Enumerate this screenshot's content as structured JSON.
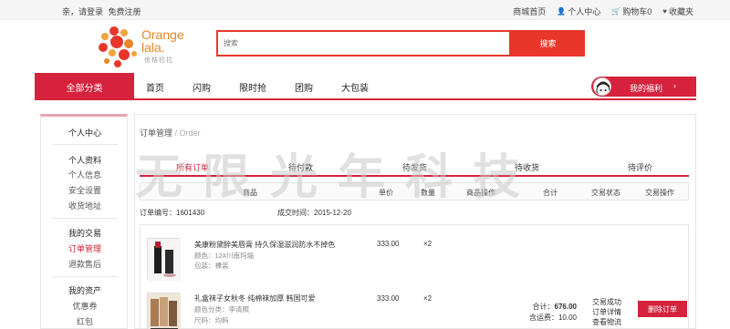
{
  "topbar": {
    "greeting": "亲，请登录",
    "register": "免费注册",
    "mall_home": "商城首页",
    "personal_center": "个人中心",
    "cart": "购物车0",
    "favorites": "收藏夹"
  },
  "header": {
    "logo_line1": "Orange",
    "logo_line2": "lala.",
    "logo_sub": "优桔拉拉",
    "search_placeholder": "搜索",
    "search_button": "搜索"
  },
  "nav": {
    "all_categories": "全部分类",
    "items": [
      "首页",
      "闪购",
      "限时抢",
      "团购",
      "大包装"
    ],
    "benefit": "我的福利",
    "benefit_arrow": "›"
  },
  "sidebar": {
    "title": "个人中心",
    "sections": [
      {
        "head": "个人资料",
        "items": [
          "个人信息",
          "安全设置",
          "收货地址"
        ]
      },
      {
        "head": "我的交易",
        "items": [
          "订单管理",
          "退款售后"
        ]
      },
      {
        "head": "我的资产",
        "items": [
          "优惠券",
          "红包"
        ]
      }
    ]
  },
  "main": {
    "breadcrumb": "订单管理",
    "breadcrumb_sub": "Order",
    "tabs": [
      "所有订单",
      "待付款",
      "待发货",
      "待收货",
      "待评价"
    ],
    "table_headers": [
      "商品",
      "单价",
      "数量",
      "商品操作",
      "合计",
      "交易状态",
      "交易操作"
    ],
    "order": {
      "number_label": "订单编号：",
      "number": "1601430",
      "time_label": "成交时间：",
      "time": "2015-12-20",
      "products": [
        {
          "name": "美康粉黛醉美唇膏 持久保湿滋润防水不掉色",
          "meta1": "颜色：12#川南玛瑙",
          "meta2": "包装：裸装",
          "price": "333.00",
          "qty": "×2"
        },
        {
          "name": "礼盒袜子女秋冬 纯棉袜加厚 韩国可爱",
          "meta1": "颜色分类：李清照",
          "meta2": "尺码：均码",
          "price": "333.00",
          "qty": "×2"
        }
      ],
      "total_label": "合计：",
      "total": "676.00",
      "shipping_label": "含运费：",
      "shipping": "10.00",
      "status_lines": [
        "交易成功",
        "订单详情",
        "查看物流"
      ],
      "delete_button": "删除订单"
    }
  },
  "watermark": "无限光年科技",
  "colors": {
    "brand_red": "#d6223c",
    "search_red": "#e8372a",
    "logo_orange": "#e8862a"
  }
}
